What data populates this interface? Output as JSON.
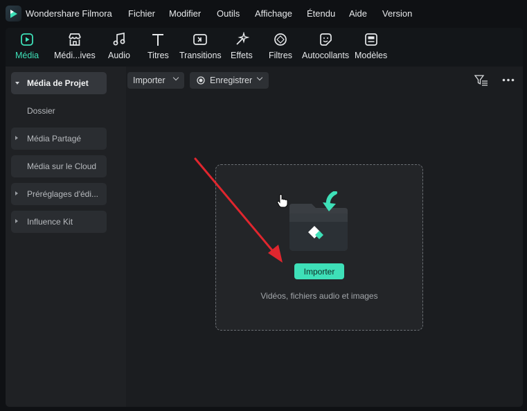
{
  "app": {
    "title": "Wondershare Filmora",
    "accent_color": "#3ee0b8"
  },
  "menubar": {
    "items": [
      "Fichier",
      "Modifier",
      "Outils",
      "Affichage",
      "Étendu",
      "Aide",
      "Version"
    ]
  },
  "toolbar": {
    "tabs": [
      {
        "label": "Média",
        "icon": "media-icon",
        "active": true
      },
      {
        "label": "Médi...ives",
        "icon": "store-icon",
        "active": false
      },
      {
        "label": "Audio",
        "icon": "music-note-icon",
        "active": false
      },
      {
        "label": "Titres",
        "icon": "text-icon",
        "active": false
      },
      {
        "label": "Transitions",
        "icon": "transition-icon",
        "active": false
      },
      {
        "label": "Effets",
        "icon": "effects-icon",
        "active": false
      },
      {
        "label": "Filtres",
        "icon": "filter-icon",
        "active": false
      },
      {
        "label": "Autocollants",
        "icon": "sticker-icon",
        "active": false
      },
      {
        "label": "Modèles",
        "icon": "template-icon",
        "active": false
      }
    ]
  },
  "sidebar": {
    "items": [
      {
        "label": "Média de Projet",
        "expanded": true,
        "active": true
      },
      {
        "label": "Dossier"
      },
      {
        "label": "Média Partagé",
        "expandable": true
      },
      {
        "label": "Média sur le Cloud"
      },
      {
        "label": "Préréglages d'édi...",
        "expandable": true
      },
      {
        "label": "Influence Kit",
        "expandable": true
      }
    ]
  },
  "content": {
    "import_dropdown": "Importer",
    "record_dropdown": "Enregistrer",
    "filter_icon": "filter-list-icon",
    "more_icon": "more-horizontal-icon",
    "dropzone": {
      "button_label": "Importer",
      "hint": "Vidéos, fichiers audio et images"
    }
  }
}
